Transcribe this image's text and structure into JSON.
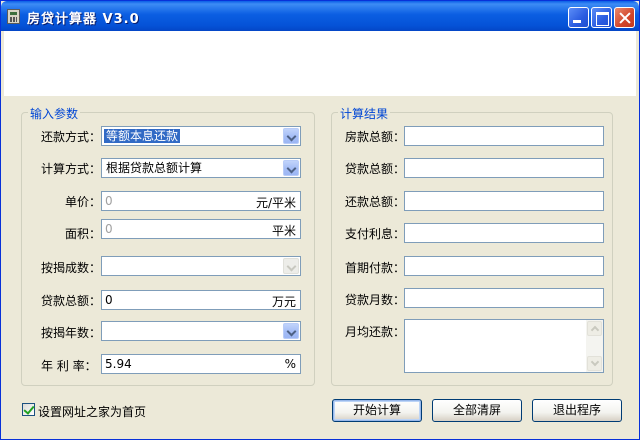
{
  "window": {
    "title": "房贷计算器 V3.0"
  },
  "input_group": {
    "legend": "输入参数",
    "repay_method": {
      "label": "还款方式：",
      "value": "等额本息还款"
    },
    "calc_method": {
      "label": "计算方式：",
      "value": "根据贷款总额计算"
    },
    "unit_price": {
      "label": "单价：",
      "placeholder": "0",
      "unit": "元/平米"
    },
    "area": {
      "label": "面积：",
      "placeholder": "0",
      "unit": "平米"
    },
    "mortgage_ratio": {
      "label": "按揭成数：",
      "value": ""
    },
    "loan_total": {
      "label": "贷款总额：",
      "value": "0",
      "unit": "万元"
    },
    "mortgage_years": {
      "label": "按揭年数：",
      "value": ""
    },
    "annual_rate": {
      "label": "年 利 率：",
      "value": "5.94",
      "unit": "%"
    }
  },
  "result_group": {
    "legend": "计算结果",
    "house_total": {
      "label": "房款总额：",
      "value": ""
    },
    "loan_total": {
      "label": "贷款总额：",
      "value": ""
    },
    "repay_total": {
      "label": "还款总额：",
      "value": ""
    },
    "interest": {
      "label": "支付利息：",
      "value": ""
    },
    "down_payment": {
      "label": "首期付款：",
      "value": ""
    },
    "loan_months": {
      "label": "贷款月数：",
      "value": ""
    },
    "monthly_payment": {
      "label": "月均还款：",
      "value": ""
    }
  },
  "footer": {
    "homepage_checkbox": {
      "label": "设置网址之家为首页",
      "checked": true
    },
    "start_button": "开始计算",
    "clear_button": "全部清屏",
    "exit_button": "退出程序"
  },
  "colors": {
    "accent": "#0046D5",
    "title_bar": "#0553D8",
    "selection": "#316AC5"
  }
}
